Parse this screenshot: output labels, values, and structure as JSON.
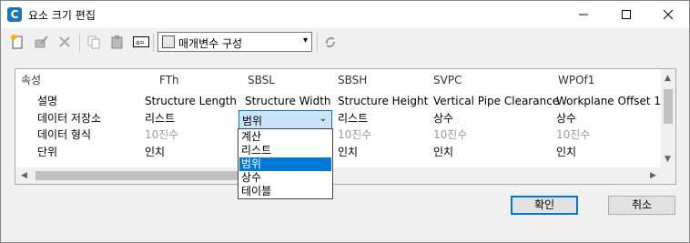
{
  "window": {
    "title": "요소 크기 편집",
    "app_icon_letter": "C"
  },
  "toolbar": {
    "config_combo": "매개변수 구성"
  },
  "table": {
    "row_header_label": "속성",
    "columns": [
      "FTh",
      "SBSL",
      "SBSH",
      "SVPC",
      "WPOf1"
    ],
    "rows": [
      {
        "label": "설명",
        "values": [
          "Structure Length",
          "Structure Width",
          "Structure Height",
          "Vertical Pipe Clearance",
          "Workplane Offset 1"
        ]
      },
      {
        "label": "데이터 저장소",
        "values": [
          "리스트",
          "범위",
          "리스트",
          "상수",
          "상수"
        ]
      },
      {
        "label": "데이터 형식",
        "values": [
          "10진수",
          "",
          "10진수",
          "10진수",
          "10진수"
        ]
      },
      {
        "label": "단위",
        "values": [
          "인치",
          "",
          "인치",
          "인치",
          "인치"
        ]
      }
    ]
  },
  "dropdown": {
    "selected": "범위",
    "options": [
      "계산",
      "리스트",
      "범위",
      "상수",
      "테이블"
    ]
  },
  "buttons": {
    "ok": "확인",
    "cancel": "취소"
  }
}
